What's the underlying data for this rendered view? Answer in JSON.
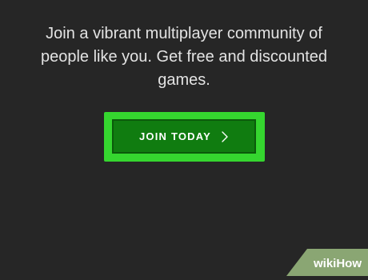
{
  "promo": {
    "line1": "Join a vibrant multiplayer community of",
    "line2": "people like you. Get free and discounted",
    "line3": "games."
  },
  "cta": {
    "label": "JOIN TODAY",
    "icon": "chevron-right-icon"
  },
  "watermark": {
    "text": "wikiHow"
  },
  "colors": {
    "background": "#262626",
    "text": "#e3e3e3",
    "button": "#107c10",
    "highlight": "#35d62f",
    "watermark_band": "#8aa673"
  }
}
